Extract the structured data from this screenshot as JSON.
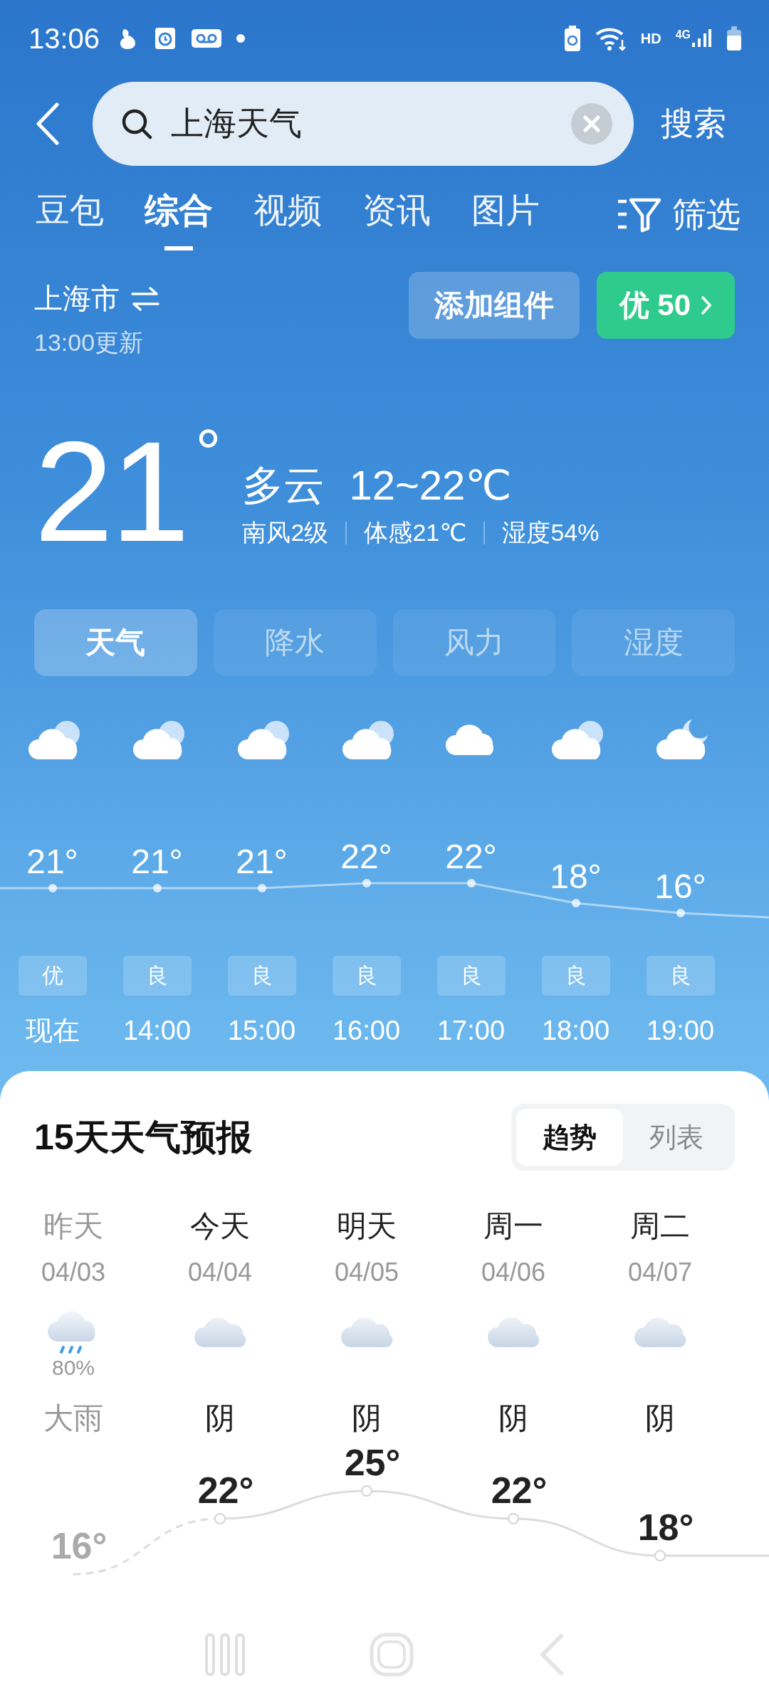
{
  "status_bar": {
    "time": "13:06",
    "hd": "HD",
    "network": "4G"
  },
  "search": {
    "value": "上海天气",
    "button": "搜索"
  },
  "tabs": [
    {
      "label": "豆包",
      "selected": false
    },
    {
      "label": "综合",
      "selected": true
    },
    {
      "label": "视频",
      "selected": false
    },
    {
      "label": "资讯",
      "selected": false
    },
    {
      "label": "图片",
      "selected": false
    }
  ],
  "filter": {
    "label": "筛选"
  },
  "location": {
    "city": "上海市",
    "updated": "13:00更新"
  },
  "actions": [
    {
      "kind": "widget",
      "label": "添加组件"
    },
    {
      "kind": "aqi",
      "label": "优 50"
    }
  ],
  "current": {
    "temp": "21",
    "unit": "°",
    "condition": "多云",
    "range": "12~22℃",
    "details": [
      "南风2级",
      "体感21℃",
      "湿度54%"
    ]
  },
  "views": [
    {
      "label": "天气",
      "selected": true
    },
    {
      "label": "降水",
      "selected": false
    },
    {
      "label": "风力",
      "selected": false
    },
    {
      "label": "湿度",
      "selected": false
    }
  ],
  "hourly": [
    {
      "kind": "partly_cloudy",
      "temp": "21°",
      "aqi": "优",
      "time": "现在"
    },
    {
      "kind": "partly_cloudy",
      "temp": "21°",
      "aqi": "良",
      "time": "14:00"
    },
    {
      "kind": "partly_cloudy",
      "temp": "21°",
      "aqi": "良",
      "time": "15:00"
    },
    {
      "kind": "partly_cloudy",
      "temp": "22°",
      "aqi": "良",
      "time": "16:00"
    },
    {
      "kind": "cloudy",
      "temp": "22°",
      "aqi": "良",
      "time": "17:00"
    },
    {
      "kind": "partly_cloudy",
      "temp": "18°",
      "aqi": "良",
      "time": "18:00"
    },
    {
      "kind": "partly_cloudy_night",
      "temp": "16°",
      "aqi": "良",
      "time": "19:00"
    }
  ],
  "forecast": {
    "title": "15天天气预报",
    "modes": [
      {
        "label": "趋势",
        "selected": true
      },
      {
        "label": "列表",
        "selected": false
      }
    ],
    "days": [
      {
        "day": "昨天",
        "date": "04/03",
        "kind": "rain",
        "precip": "80%",
        "condition": "大雨",
        "high": "16°",
        "past": true
      },
      {
        "day": "今天",
        "date": "04/04",
        "kind": "overcast",
        "condition": "阴",
        "high": "22°",
        "past": false
      },
      {
        "day": "明天",
        "date": "04/05",
        "kind": "overcast",
        "condition": "阴",
        "high": "25°",
        "past": false
      },
      {
        "day": "周一",
        "date": "04/06",
        "kind": "overcast",
        "condition": "阴",
        "high": "22°",
        "past": false
      },
      {
        "day": "周二",
        "date": "04/07",
        "kind": "overcast",
        "condition": "阴",
        "high": "18°",
        "past": false
      }
    ]
  }
}
